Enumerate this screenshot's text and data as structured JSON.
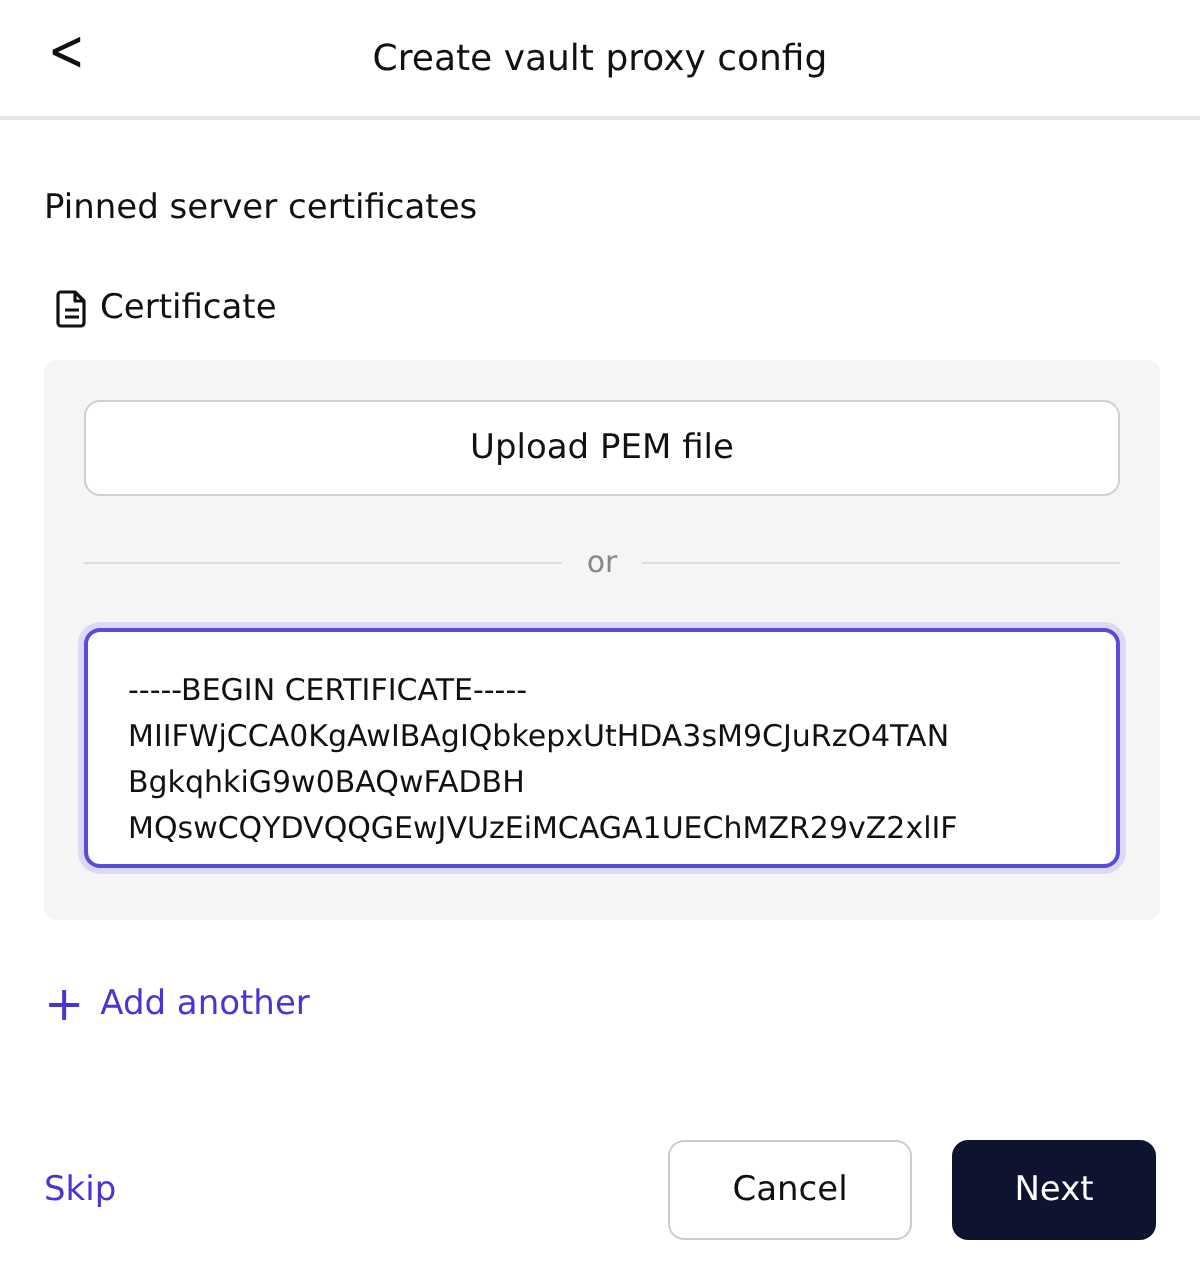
{
  "header": {
    "back": "<",
    "title": "Create vault proxy config"
  },
  "section": {
    "title": "Pinned server certificates",
    "label": "Certificate"
  },
  "upload_button": "Upload PEM file",
  "divider": "or",
  "certificate_field": {
    "focused": true,
    "lines": [
      "-----BEGIN CERTIFICATE-----",
      "MIIFWjCCA0KgAwIBAgIQbkepxUtHDA3sM9CJuRzO4TAN",
      "BgkqhkiG9w0BAQwFADBH",
      "MQswCQYDVQQGEwJVUzEiMCAGA1UEChMZR29vZ2xlIF"
    ]
  },
  "add_another": {
    "icon": "+",
    "label": "Add another"
  },
  "footer": {
    "skip": "Skip",
    "cancel": "Cancel",
    "next": "Next"
  }
}
